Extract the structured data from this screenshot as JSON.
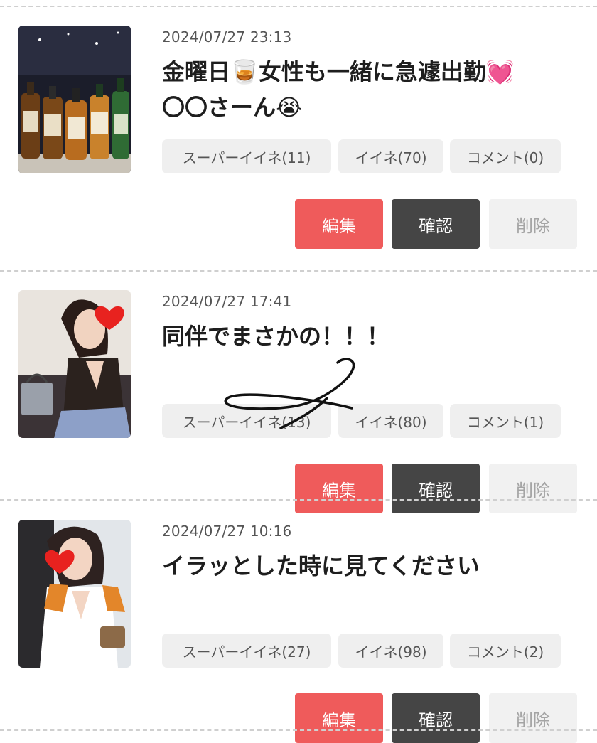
{
  "posts": [
    {
      "date": "2024/07/27 23:13",
      "title_line1": "金曜日🥃女性も一緒に急遽出勤💓",
      "title_line2": "〇〇さーん😭",
      "super_like": "スーパーイイネ(11)",
      "like": "イイネ(70)",
      "comment": "コメント(0)",
      "edit": "編集",
      "confirm": "確認",
      "delete": "削除"
    },
    {
      "date": "2024/07/27 17:41",
      "title_line1": "同伴でまさかの！！！",
      "title_line2": "",
      "super_like": "スーパーイイネ(13)",
      "like": "イイネ(80)",
      "comment": "コメント(1)",
      "edit": "編集",
      "confirm": "確認",
      "delete": "削除"
    },
    {
      "date": "2024/07/27 10:16",
      "title_line1": "イラッとした時に見てください",
      "title_line2": "",
      "super_like": "スーパーイイネ(27)",
      "like": "イイネ(98)",
      "comment": "コメント(2)",
      "edit": "編集",
      "confirm": "確認",
      "delete": "削除"
    }
  ],
  "colors": {
    "edit_button": "#ef5b5b",
    "confirm_button": "#454545",
    "delete_button": "#f1f1f1",
    "pill_background": "#efefef",
    "divider": "#cfcfcf"
  },
  "icons": {
    "post1_thumb": "whisky-bottles-photo",
    "post2_thumb": "woman-photo-heart-sticker",
    "post3_thumb": "woman-photo-heart-sticker",
    "overlay": "handwritten-scribble"
  }
}
